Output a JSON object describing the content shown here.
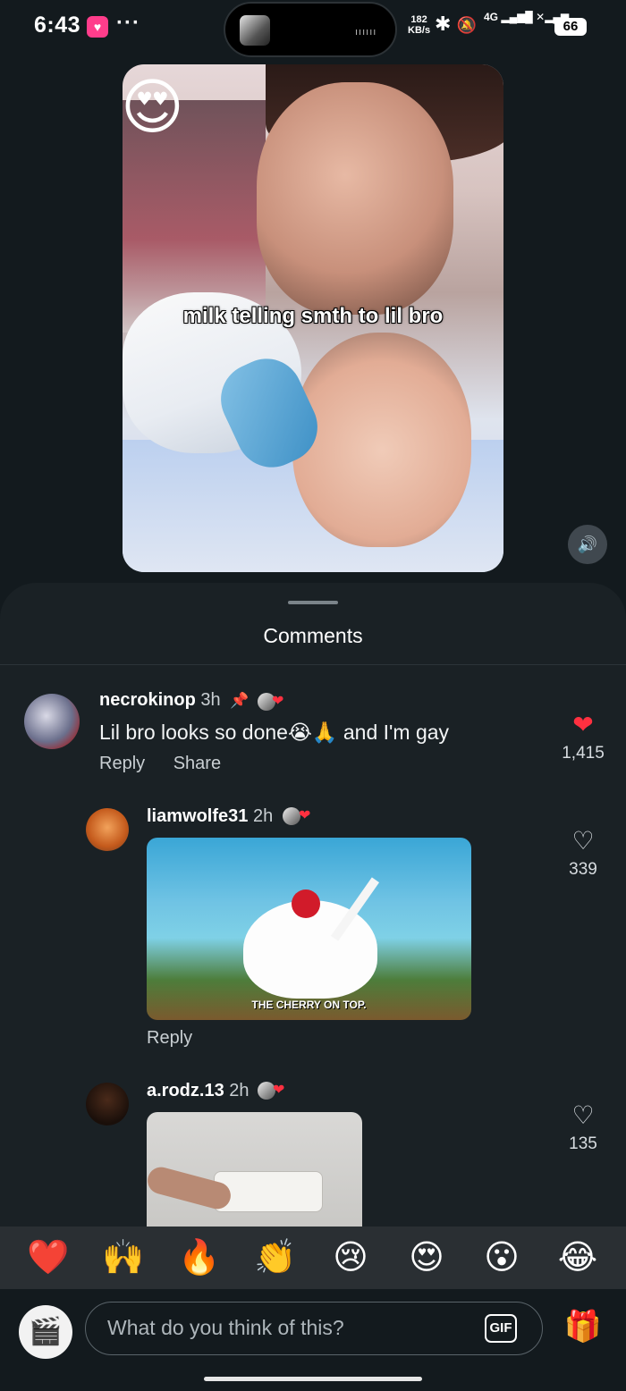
{
  "status": {
    "time": "6:43",
    "app_badge": "♥",
    "more": "···",
    "net_speed_value": "182",
    "net_speed_unit": "KB/s",
    "icons": [
      "bluetooth-icon",
      "mute-icon",
      "signal-icon",
      "battery-icon"
    ],
    "network": "4G",
    "battery": "66"
  },
  "video": {
    "caption": "milk telling smth to lil bro",
    "sticker": "😍"
  },
  "sheet": {
    "title": "Comments"
  },
  "comments": [
    {
      "username": "necrokinop",
      "time": "3h",
      "pinned": true,
      "text": "Lil bro looks so done😭🙏 and I'm gay",
      "actions": [
        "Reply",
        "Share"
      ],
      "likes": "1,415",
      "liked": true
    },
    {
      "username": "liamwolfe31",
      "time": "2h",
      "gif_caption": "THE CHERRY ON TOP.",
      "actions": [
        "Reply"
      ],
      "likes": "339",
      "liked": false
    },
    {
      "username": "a.rodz.13",
      "time": "2h",
      "likes": "135",
      "liked": false
    }
  ],
  "reactions": [
    "❤️",
    "🙌",
    "🔥",
    "👏",
    "😢",
    "😍",
    "😮",
    "😂"
  ],
  "composer": {
    "placeholder": "What do you think of this?",
    "gif_label": "GIF",
    "avatar_emoji": "🎬"
  },
  "colors": {
    "background": "#131a1e",
    "sheet": "#1a2125",
    "like_red": "#ff3040"
  }
}
